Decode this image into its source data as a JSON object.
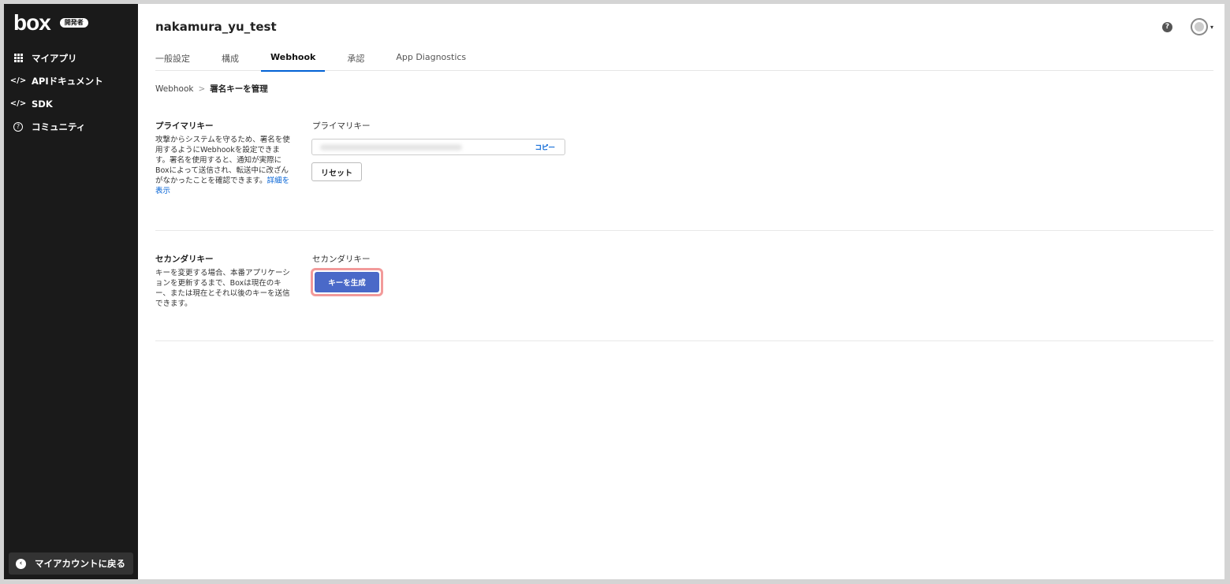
{
  "sidebar": {
    "logo": "box",
    "badge": "開発者",
    "items": [
      {
        "label": "マイアプリ"
      },
      {
        "label": "APIドキュメント"
      },
      {
        "label": "SDK"
      },
      {
        "label": "コミュニティ"
      }
    ],
    "back_label": "マイアカウントに戻る"
  },
  "header": {
    "app_name": "nakamura_yu_test",
    "tabs": [
      {
        "label": "一般設定"
      },
      {
        "label": "構成"
      },
      {
        "label": "Webhook",
        "active": true
      },
      {
        "label": "承認"
      },
      {
        "label": "App Diagnostics"
      }
    ]
  },
  "breadcrumb": {
    "parent": "Webhook",
    "separator": ">",
    "current": "署名キーを管理"
  },
  "primary": {
    "title": "プライマリキー",
    "description": "攻撃からシステムを守るため、署名を使用するようにWebhookを設定できます。署名を使用すると、通知が実際にBoxによって送信され、転送中に改ざんがなかったことを確認できます。",
    "link_text": "詳細を表示",
    "field_label": "プライマリキー",
    "copy_label": "コピー",
    "reset_label": "リセット"
  },
  "secondary": {
    "title": "セカンダリキー",
    "description": "キーを変更する場合、本番アプリケーションを更新するまで、Boxは現在のキー、または現在とそれ以後のキーを送信できます。",
    "field_label": "セカンダリキー",
    "generate_label": "キーを生成"
  },
  "colors": {
    "sidebar_bg": "#1a1a1a",
    "accent": "#0061d5",
    "generate_button": "#4a69c8",
    "highlight": "#f29a9a"
  },
  "icons": {
    "my_apps": "grid-icon",
    "api_docs": "code-icon",
    "sdk": "code-icon",
    "community": "help-circle-icon",
    "back": "chevron-left-icon",
    "help": "help-icon",
    "avatar": "avatar-icon"
  }
}
